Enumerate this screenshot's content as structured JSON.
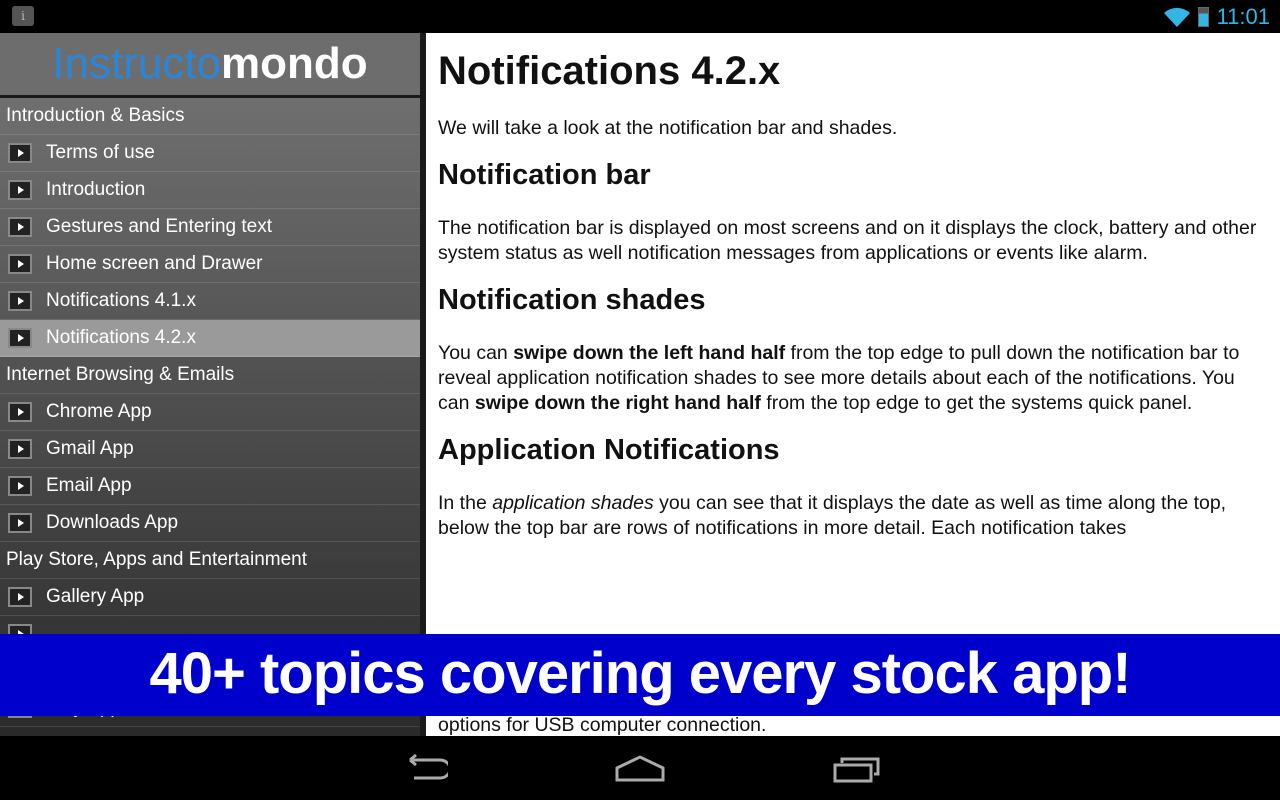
{
  "status_bar": {
    "time": "11:01",
    "notification_icon": "info-icon",
    "icons": [
      "wifi-icon",
      "battery-icon"
    ]
  },
  "sidebar": {
    "logo": {
      "part1": "Instructo",
      "part2": "mondo"
    },
    "rows": [
      {
        "type": "section",
        "label": "Introduction & Basics"
      },
      {
        "type": "item",
        "label": "Terms of use"
      },
      {
        "type": "item",
        "label": "Introduction"
      },
      {
        "type": "item",
        "label": "Gestures and Entering text"
      },
      {
        "type": "item",
        "label": "Home screen and Drawer"
      },
      {
        "type": "item",
        "label": "Notifications 4.1.x"
      },
      {
        "type": "item",
        "label": "Notifications 4.2.x",
        "selected": true
      },
      {
        "type": "section",
        "label": "Internet Browsing & Emails"
      },
      {
        "type": "item",
        "label": "Chrome App"
      },
      {
        "type": "item",
        "label": "Gmail App"
      },
      {
        "type": "item",
        "label": "Email App"
      },
      {
        "type": "item",
        "label": "Downloads App"
      },
      {
        "type": "section",
        "label": "Play Store, Apps and Entertainment"
      },
      {
        "type": "item",
        "label": "Gallery App"
      },
      {
        "type": "item",
        "label": ""
      },
      {
        "type": "item",
        "label": ""
      },
      {
        "type": "item",
        "label": "Play Apps"
      }
    ]
  },
  "content": {
    "title": "Notifications 4.2.x",
    "intro": "We will take a look at the notification bar and shades.",
    "s1_title": "Notification bar",
    "s1_text": "The notification bar is displayed on most screens and on it displays the clock, battery and other system status as well notification messages from applications or events like alarm.",
    "s2_title": "Notification shades",
    "s2_a": "You can ",
    "s2_b": "swipe down the left hand half",
    "s2_c": " from the top edge to pull down the notification bar to reveal application notification shades to see more details about each of the notifications. You can ",
    "s2_d": "swipe down the right hand half",
    "s2_e": " from the top edge to get the systems quick panel.",
    "s3_title": "Application Notifications",
    "s3_a": "In the ",
    "s3_b": "application shades",
    "s3_c": " you can see that it displays the date as well as time along the top, below the top bar are rows of notifications in more detail. Each notification takes",
    "s3_tail": "options for USB computer connection."
  },
  "banner": {
    "text": "40+ topics covering every stock app!",
    "color": "#0000cc"
  },
  "nav_bar": {
    "buttons": [
      "back-icon",
      "home-icon",
      "recents-icon"
    ]
  }
}
